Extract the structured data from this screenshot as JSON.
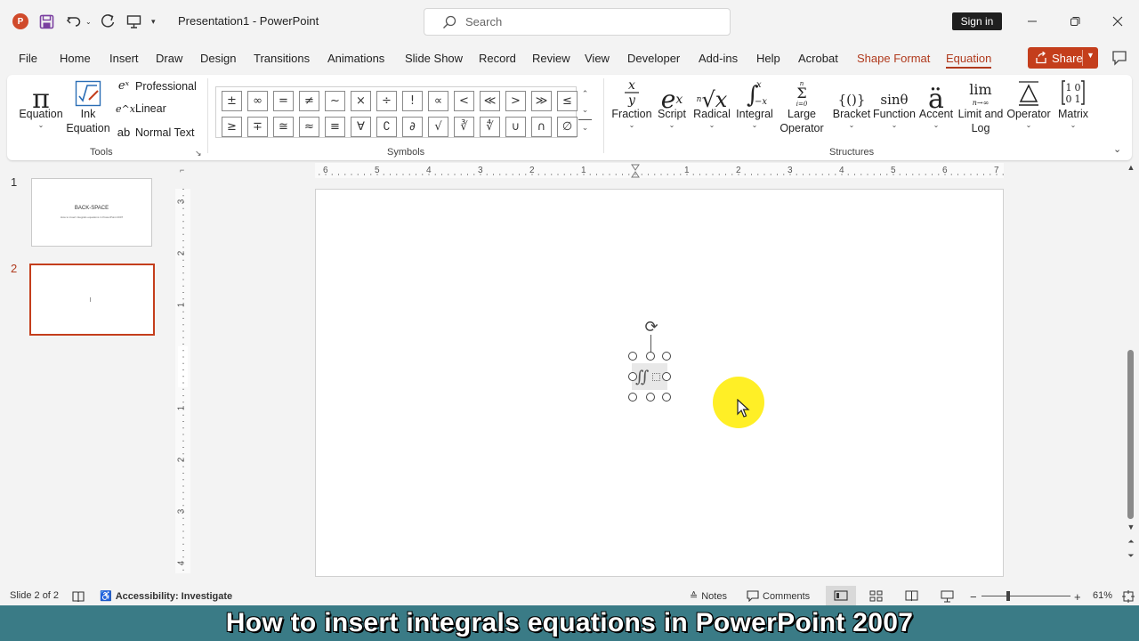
{
  "app": {
    "logo_letter": "P",
    "title": "Presentation1 - PowerPoint",
    "search_placeholder": "Search",
    "signin_label": "Sign in",
    "share_label": "Share"
  },
  "menu": {
    "tabs": [
      "File",
      "Home",
      "Insert",
      "Draw",
      "Design",
      "Transitions",
      "Animations",
      "Slide Show",
      "Record",
      "Review",
      "View",
      "Developer",
      "Add-ins",
      "Help",
      "Acrobat",
      "Shape Format",
      "Equation"
    ],
    "active": "Equation",
    "contextual": [
      "Shape Format"
    ]
  },
  "ribbon": {
    "tools": {
      "equation_label": "Equation",
      "ink_equation_label": "Ink Equation",
      "professional_label": "Professional",
      "linear_label": "Linear",
      "normal_text_label": "Normal Text",
      "group_label": "Tools"
    },
    "symbols": {
      "row1": [
        "±",
        "∞",
        "=",
        "≠",
        "~",
        "×",
        "÷",
        "!",
        "∝",
        "<",
        "≪",
        ">",
        "≫",
        "≤"
      ],
      "row2": [
        "≥",
        "∓",
        "≅",
        "≈",
        "≡",
        "∀",
        "∁",
        "∂",
        "√",
        "∛",
        "∜",
        "∪",
        "∩",
        "∅"
      ],
      "group_label": "Symbols"
    },
    "structures": {
      "items": [
        "Fraction",
        "Script",
        "Radical",
        "Integral",
        "Large Operator",
        "Bracket",
        "Function",
        "Accent",
        "Limit and Log",
        "Operator",
        "Matrix"
      ],
      "group_label": "Structures"
    }
  },
  "slides_pane": {
    "slides": [
      {
        "number": "1",
        "title": "BACK-SPACE",
        "subtitle": "How to insert integrals equations in PowerPoint 2007"
      },
      {
        "number": "2",
        "title": "",
        "subtitle": ""
      }
    ],
    "selected": "2"
  },
  "rulers": {
    "horizontal": [
      "6",
      "5",
      "4",
      "3",
      "2",
      "1",
      "1",
      "2",
      "3",
      "4",
      "5",
      "6",
      "7"
    ],
    "vertical": [
      "3",
      "2",
      "1",
      "1",
      "2",
      "3",
      "4"
    ]
  },
  "status": {
    "slide_info": "Slide 2 of 2",
    "accessibility": "Accessibility: Investigate",
    "notes": "Notes",
    "comments": "Comments",
    "zoom": "61%"
  },
  "caption": "How to insert integrals equations in PowerPoint 2007",
  "colors": {
    "accent": "#c43e1c",
    "caption_bg": "#3a7b86",
    "highlight": "#ffec00"
  }
}
